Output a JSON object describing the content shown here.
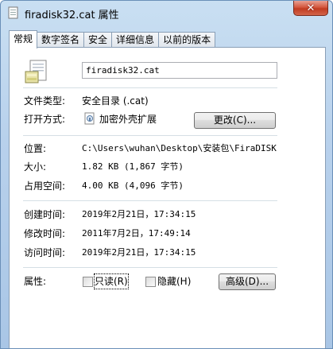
{
  "window": {
    "title": "firadisk32.cat 属性",
    "close_symbol": "✕"
  },
  "tabs": [
    {
      "label": "常规",
      "active": true
    },
    {
      "label": "数字签名"
    },
    {
      "label": "安全"
    },
    {
      "label": "详细信息"
    },
    {
      "label": "以前的版本"
    }
  ],
  "general": {
    "file_name": "firadisk32.cat",
    "file_type_label": "文件类型:",
    "file_type_value": "安全目录 (.cat)",
    "open_with_label": "打开方式:",
    "open_with_value": "加密外壳扩展",
    "change_button": "更改(C)...",
    "location_label": "位置:",
    "location_value": "C:\\Users\\wuhan\\Desktop\\安装包\\FiraDISK",
    "size_label": "大小:",
    "size_value": "1.82 KB (1,867 字节)",
    "size_on_disk_label": "占用空间:",
    "size_on_disk_value": "4.00 KB (4,096 字节)",
    "created_label": "创建时间:",
    "created_value": "2019年2月21日，17:34:15",
    "modified_label": "修改时间:",
    "modified_value": "2011年7月2日，17:49:14",
    "accessed_label": "访问时间:",
    "accessed_value": "2019年2月21日，17:34:15",
    "attributes_label": "属性:",
    "readonly_label": "只读(R)",
    "hidden_label": "隐藏(H)",
    "advanced_button": "高级(D)..."
  }
}
